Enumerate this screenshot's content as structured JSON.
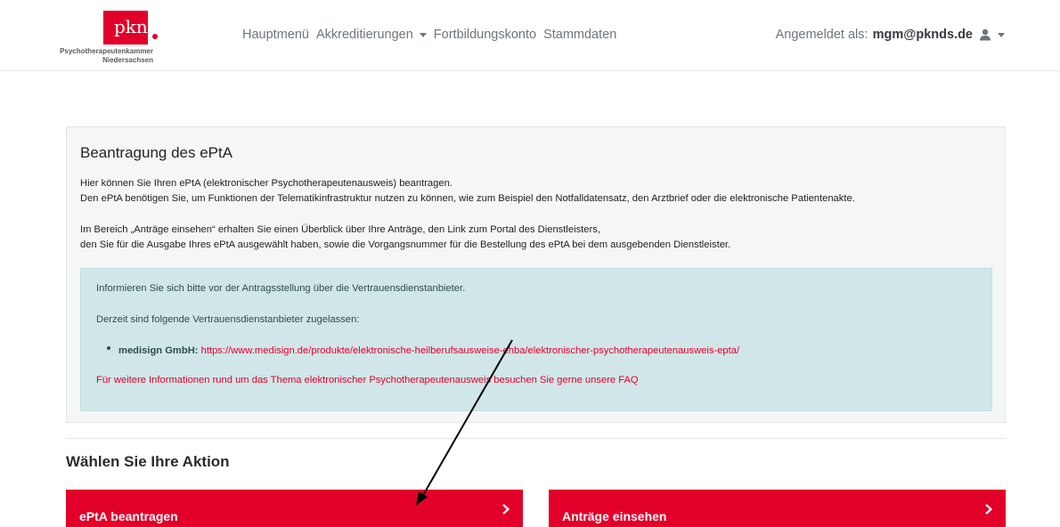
{
  "logo": {
    "text": "pkn",
    "sub_line1": "Psychotherapeutenkammer",
    "sub_line2": "Niedersachsen"
  },
  "nav": {
    "items": [
      {
        "label": "Hauptmenü"
      },
      {
        "label": "Akkreditierungen"
      },
      {
        "label": "Fortbildungskonto"
      },
      {
        "label": "Stammdaten"
      }
    ]
  },
  "user": {
    "prefix": "Angemeldet als:",
    "email": "mgm@pknds.de"
  },
  "panel": {
    "title": "Beantragung des ePtA",
    "para1_line1": "Hier können Sie Ihren ePtA (elektronischer Psychotherapeutenausweis) beantragen.",
    "para1_line2": "Den ePtA benötigen Sie, um Funktionen der Telematikinfrastruktur nutzen zu können, wie zum Beispiel den Notfalldatensatz, den Arztbrief oder die elektronische Patientenakte.",
    "para2_line1": "Im Bereich „Anträge einsehen“ erhalten Sie einen Überblick über Ihre Anträge, den Link zum Portal des Dienstleisters,",
    "para2_line2": "den Sie für die Ausgabe Ihres ePtA ausgewählt haben, sowie die Vorgangsnummer für die Bestellung des ePtA bei dem ausgebenden Dienstleister."
  },
  "alert": {
    "line1": "Informieren Sie sich bitte vor der Antragsstellung über die Vertrauensdienstanbieter.",
    "line2": "Derzeit sind folgende Vertrauensdienstanbieter zugelassen:",
    "provider_name": "medisign GmbH:",
    "provider_url": "https://www.medisign.de/produkte/elektronische-heilberufsausweise-ehba/elektronischer-psychotherapeutenausweis-epta/",
    "faq_text": "Für weitere Informationen rund um das Thema elektronischer Psychotherapeutenausweis besuchen Sie gerne unsere FAQ"
  },
  "actions": {
    "title": "Wählen Sie Ihre Aktion",
    "btn1_label": "ePtA beantragen",
    "btn2_label": "Anträge einsehen"
  },
  "colors": {
    "brand_red": "#e2002a",
    "alert_bg": "#d1e6e8",
    "panel_bg": "#f5f7f7"
  },
  "icons": {
    "user": "user-icon",
    "dropdown": "caret-down-icon",
    "chevron": "chevron-right-icon",
    "annotation": "arrow-annotation"
  }
}
